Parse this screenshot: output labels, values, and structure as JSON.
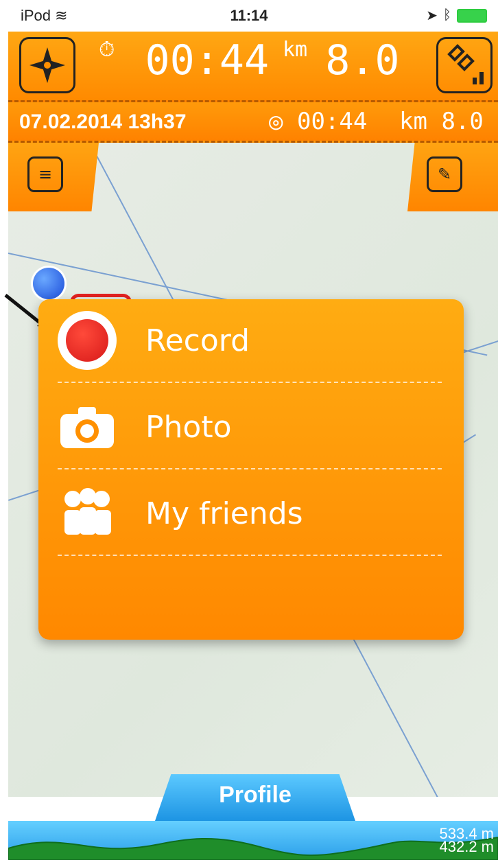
{
  "status_bar": {
    "carrier": "iPod",
    "time": "11:14"
  },
  "top_bar": {
    "time_value": "00:44",
    "distance_value": "8.0",
    "distance_unit": "km"
  },
  "info_bar": {
    "datetime": "07.02.2014 13h37",
    "duration": "00:44",
    "distance": "8.0",
    "distance_unit": "km"
  },
  "popup_menu": {
    "items": [
      {
        "label": "Record",
        "icon": "record-icon"
      },
      {
        "label": "Photo",
        "icon": "camera-icon"
      },
      {
        "label": "My friends",
        "icon": "friends-icon"
      }
    ]
  },
  "profile_panel": {
    "tab_label": "Profile",
    "max_elevation": "533.4 m",
    "min_elevation": "432.2 m"
  },
  "colors": {
    "accent_orange": "#ff9000",
    "profile_blue": "#29a0ea",
    "record_red": "#e01a1a"
  }
}
